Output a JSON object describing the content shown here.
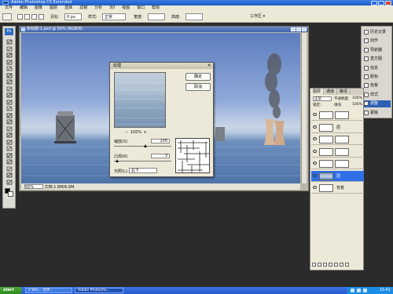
{
  "window": {
    "title": "Adobe Photoshop CS Extended"
  },
  "menu": [
    "文件",
    "编辑",
    "图像",
    "图层",
    "选择",
    "滤镜",
    "分析",
    "3D",
    "视图",
    "窗口",
    "帮助"
  ],
  "options_bar": {
    "feather_label": "羽化:",
    "feather_value": "0 px",
    "style_label": "样式:",
    "style_value": "正常",
    "width_label": "宽度:",
    "height_label": "高度:",
    "workspace_label": "工作区 ▾"
  },
  "tools": {
    "logo": "Ps",
    "icons": [
      "move-tool-icon",
      "marquee-tool-icon",
      "lasso-tool-icon",
      "quick-select-tool-icon",
      "crop-tool-icon",
      "eyedropper-tool-icon",
      "healing-brush-icon",
      "brush-tool-icon",
      "clone-stamp-icon",
      "history-brush-icon",
      "eraser-tool-icon",
      "gradient-tool-icon",
      "blur-tool-icon",
      "dodge-tool-icon",
      "pen-tool-icon",
      "type-tool-icon",
      "path-select-icon",
      "shape-tool-icon",
      "3d-rotate-icon",
      "3d-orbit-icon",
      "hand-tool-icon",
      "zoom-tool-icon"
    ],
    "foreground_color": "#000000",
    "background_color": "#ffffff"
  },
  "document": {
    "title": "未标题-1.psd @ 50% (RGB/8)",
    "zoom": "50%",
    "status": "文档:1.8M/6.6M"
  },
  "dialog": {
    "title": "纹理",
    "ok_label": "确定",
    "cancel_label": "取消",
    "preview_zoom": "100%",
    "zoom_out": "−",
    "zoom_in": "+",
    "scaling_label": "缩放(S)",
    "scaling_value": "100",
    "scaling_fraction": 0.55,
    "relief_label": "凸现(R)",
    "relief_value": "3",
    "relief_fraction": 0.06,
    "light_label": "光照(L):",
    "light_value": "右下"
  },
  "palette_strip": {
    "items": [
      {
        "label": "历史记录",
        "icon": "history-icon"
      },
      {
        "label": "动作",
        "icon": "actions-icon"
      },
      {
        "label": "导航器",
        "icon": "navigator-icon"
      },
      {
        "label": "直方图",
        "icon": "histogram-icon"
      },
      {
        "label": "信息",
        "icon": "info-icon"
      },
      {
        "label": "颜色",
        "icon": "color-icon"
      },
      {
        "label": "色板",
        "icon": "swatches-icon"
      },
      {
        "label": "样式",
        "icon": "styles-icon"
      },
      {
        "label": "调整",
        "icon": "adjustments-icon"
      },
      {
        "label": "蒙版",
        "icon": "masks-icon"
      }
    ],
    "active_index": 8
  },
  "layers": {
    "tabs": [
      "图层",
      "通道",
      "路径"
    ],
    "blend_mode": "正常",
    "opacity_label": "不透明度:",
    "opacity_value": "100%",
    "lock_label": "锁定:",
    "fill_label": "填充:",
    "fill_value": "100%",
    "rows": [
      {
        "name": "",
        "kind": "mask"
      },
      {
        "name": "层",
        "kind": "layer"
      },
      {
        "name": "",
        "kind": "mask"
      },
      {
        "name": "",
        "kind": "mask"
      },
      {
        "name": "",
        "kind": "mask"
      },
      {
        "name": "层",
        "kind": "image",
        "selected": true
      },
      {
        "name": "背景",
        "kind": "background"
      }
    ]
  },
  "taskbar": {
    "start_label": "start",
    "tasks": [
      "2 Win... 文件...",
      "Adobe Photosho..."
    ],
    "clock": "15:42"
  }
}
